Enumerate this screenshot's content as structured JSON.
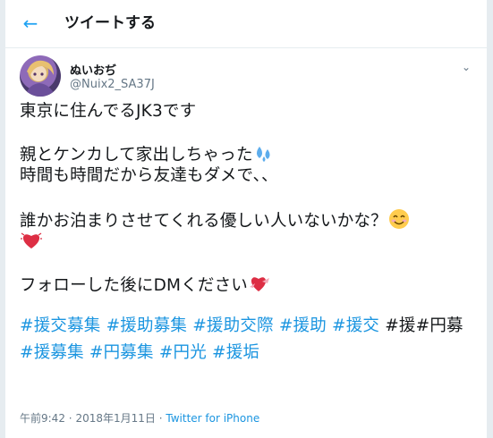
{
  "header": {
    "back_icon": "arrow-left-icon",
    "title": "ツイートする"
  },
  "author": {
    "name": "ぬいおぢ",
    "handle": "@Nuix2_SA37J"
  },
  "tweet": {
    "line1": "東京に住んでるJK3です",
    "line2": "親とケンカして家出しちゃった",
    "line3": "時間も時間だから友達もダメで、、",
    "line4": "誰かお泊まりさせてくれる優しい人いないかな？",
    "line6": "フォローした後にDMください",
    "emojis": [
      "sweat-droplets-icon",
      "smiling-face-icon",
      "beating-heart-icon",
      "heart-with-ribbon-icon"
    ]
  },
  "hashtags": {
    "row1": [
      "#援交募集",
      "#援助募集",
      "#援助交際",
      "#援助",
      "#援交"
    ],
    "row1_plain": "#援#円募",
    "row2": [
      "#援募集",
      "#円募集",
      "#円光",
      "#援垢"
    ]
  },
  "meta": {
    "time": "午前9:42",
    "sep1": "·",
    "date": "2018年1月11日",
    "sep2": "·",
    "client": "Twitter for iPhone"
  },
  "colors": {
    "accent": "#1da1f2",
    "link": "#1b95e0",
    "muted": "#657786",
    "text": "#14171a"
  }
}
